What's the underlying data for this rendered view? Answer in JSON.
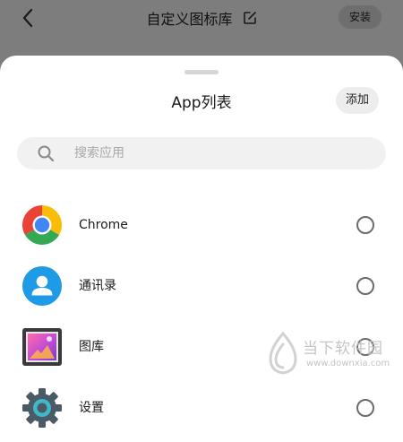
{
  "topbar": {
    "title": "自定义图标库",
    "install_label": "安装",
    "back_icon": "chevron-left-icon",
    "edit_icon": "edit-icon"
  },
  "sheet": {
    "title": "App列表",
    "add_label": "添加",
    "search": {
      "placeholder": "搜索应用",
      "value": ""
    },
    "apps": [
      {
        "name": "Chrome",
        "icon": "chrome-icon",
        "selected": false
      },
      {
        "name": "通讯录",
        "icon": "contacts-icon",
        "selected": false
      },
      {
        "name": "图库",
        "icon": "gallery-icon",
        "selected": false
      },
      {
        "name": "设置",
        "icon": "settings-icon",
        "selected": false
      }
    ]
  },
  "watermark": {
    "text": "当下软件园",
    "url": "www.downxia.com"
  },
  "colors": {
    "overlay": "#7d7d7d",
    "sheet_bg": "#ffffff",
    "search_bg": "#f1f1f1",
    "radio_border": "#6b6b6b"
  }
}
